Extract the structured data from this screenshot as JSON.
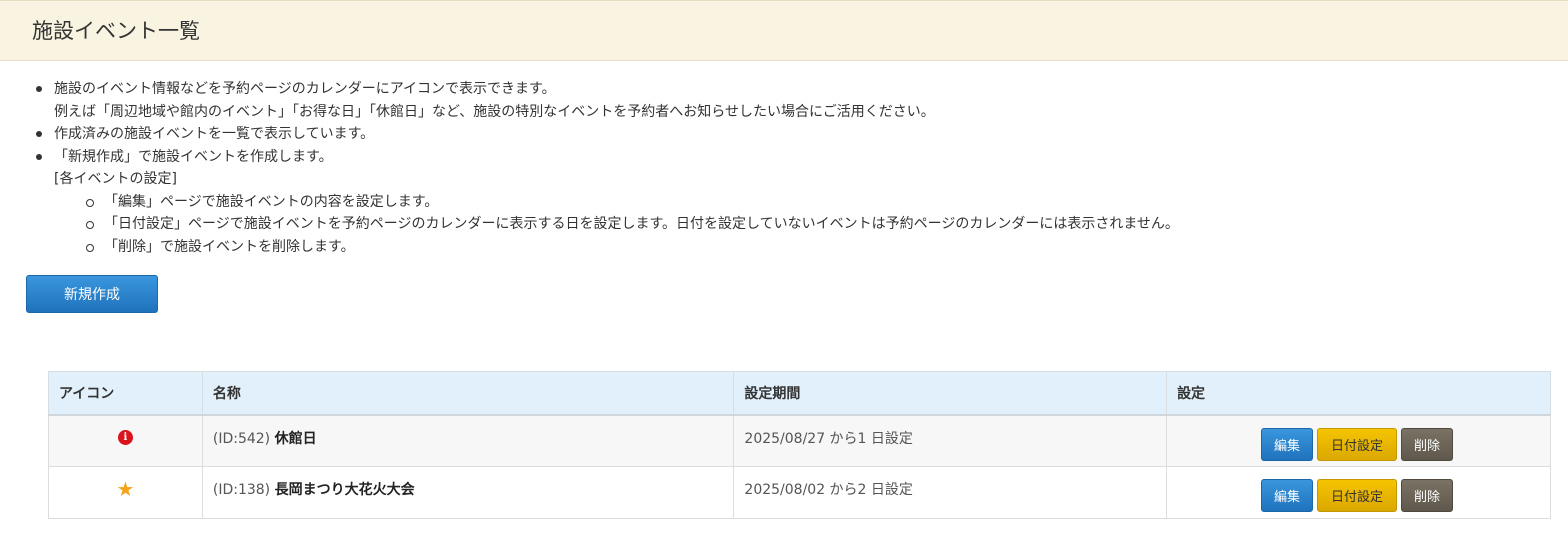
{
  "header": {
    "title": "施設イベント一覧"
  },
  "info": {
    "items": [
      "施設のイベント情報などを予約ページのカレンダーにアイコンで表示できます。",
      "例えば「周辺地域や館内のイベント」「お得な日」「休館日」など、施設の特別なイベントを予約者へお知らせしたい場合にご活用ください。",
      "作成済みの施設イベントを一覧で表示しています。",
      "「新規作成」で施設イベントを作成します。"
    ],
    "sub_heading": "[各イベントの設定]",
    "sub_items": [
      "「編集」ページで施設イベントの内容を設定します。",
      "「日付設定」ページで施設イベントを予約ページのカレンダーに表示する日を設定します。日付を設定していないイベントは予約ページのカレンダーには表示されません。",
      "「削除」で施設イベントを削除します。"
    ]
  },
  "new_button": "新規作成",
  "table": {
    "headers": [
      "アイコン",
      "名称",
      "設定期間",
      "設定"
    ],
    "rows": [
      {
        "icon": "info-icon",
        "id": "(ID:542)",
        "name": "休館日",
        "period": "2025/08/27 から1 日設定"
      },
      {
        "icon": "star-icon",
        "id": "(ID:138)",
        "name": "長岡まつり大花火大会",
        "period": "2025/08/02 から2 日設定"
      }
    ],
    "actions": {
      "edit": "編集",
      "date": "日付設定",
      "delete": "削除"
    }
  },
  "colors": {
    "header_bg": "#f9f3e1",
    "primary": "#1f73bd",
    "warning": "#dba800",
    "dark": "#5f584c",
    "table_head": "#e1f0fa"
  }
}
